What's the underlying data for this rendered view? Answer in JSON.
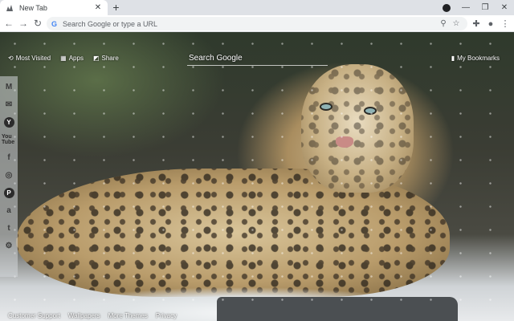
{
  "tab": {
    "title": "New Tab"
  },
  "omnibox": {
    "placeholder": "Search Google or type a URL"
  },
  "toplinks": [
    {
      "label": "Most Visited",
      "icon": "history-icon"
    },
    {
      "label": "Apps",
      "icon": "apps-grid-icon"
    },
    {
      "label": "Share",
      "icon": "share-icon"
    }
  ],
  "search": {
    "placeholder": "Search Google"
  },
  "bookmarks": {
    "label": "My Bookmarks",
    "icon": "bookmark-icon"
  },
  "sidebar": [
    {
      "name": "gmail-icon",
      "glyph": "M"
    },
    {
      "name": "mail-icon",
      "glyph": "✉"
    },
    {
      "name": "yahoo-icon",
      "glyph": "Y"
    },
    {
      "name": "youtube-icon",
      "glyph": "You Tube"
    },
    {
      "name": "facebook-icon",
      "glyph": "f"
    },
    {
      "name": "instagram-icon",
      "glyph": "◎"
    },
    {
      "name": "pinterest-icon",
      "glyph": "P"
    },
    {
      "name": "amazon-icon",
      "glyph": "a"
    },
    {
      "name": "twitter-icon",
      "glyph": "t"
    },
    {
      "name": "settings-icon",
      "glyph": "⚙"
    }
  ],
  "bottomlinks": [
    "Customer Support",
    "Wallpapers",
    "More Themes",
    "Privacy"
  ],
  "colors": {
    "tabstrip": "#dee1e6",
    "toolbar": "#ffffff",
    "omnibox": "#f1f3f4"
  }
}
